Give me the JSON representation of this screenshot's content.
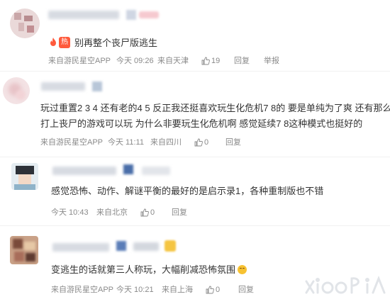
{
  "comments": [
    {
      "hot_label": "热",
      "text": "别再整个丧尸版逃生",
      "source": "来自游民星空APP",
      "time": "今天 09:26",
      "location": "来自天津",
      "likes": "19",
      "reply_label": "回复",
      "report_label": "举报"
    },
    {
      "text_line1": "玩过重置2 3 4 还有老的4 5 反正我还挺喜欢玩生化危机7 8的  要是单纯为了爽  还有那么多",
      "text_line2": "打上丧尸的游戏可以玩  为什么非要玩生化危机啊  感觉延续7 8这种模式也挺好的",
      "source": "来自游民星空APP",
      "time": "今天 11:11",
      "location": "来自四川",
      "likes": "0",
      "reply_label": "回复"
    },
    {
      "text": "感觉恐怖、动作、解谜平衡的最好的是启示录1，各种重制版也不错",
      "time": "今天 10:43",
      "location": "来自北京",
      "likes": "0",
      "reply_label": "回复"
    },
    {
      "text": "变逃生的话就第三人称玩，大幅削减恐怖氛围",
      "emoji": "grinning-sweat-emoji",
      "source": "来自游民星空APP",
      "time": "今天 10:21",
      "location": "来自上海",
      "likes": "0",
      "reply_label": "回复"
    }
  ],
  "colors": {
    "hot_tag": "#ff5a3c",
    "meta_text": "#8a8a8a",
    "body_text": "#333333"
  }
}
